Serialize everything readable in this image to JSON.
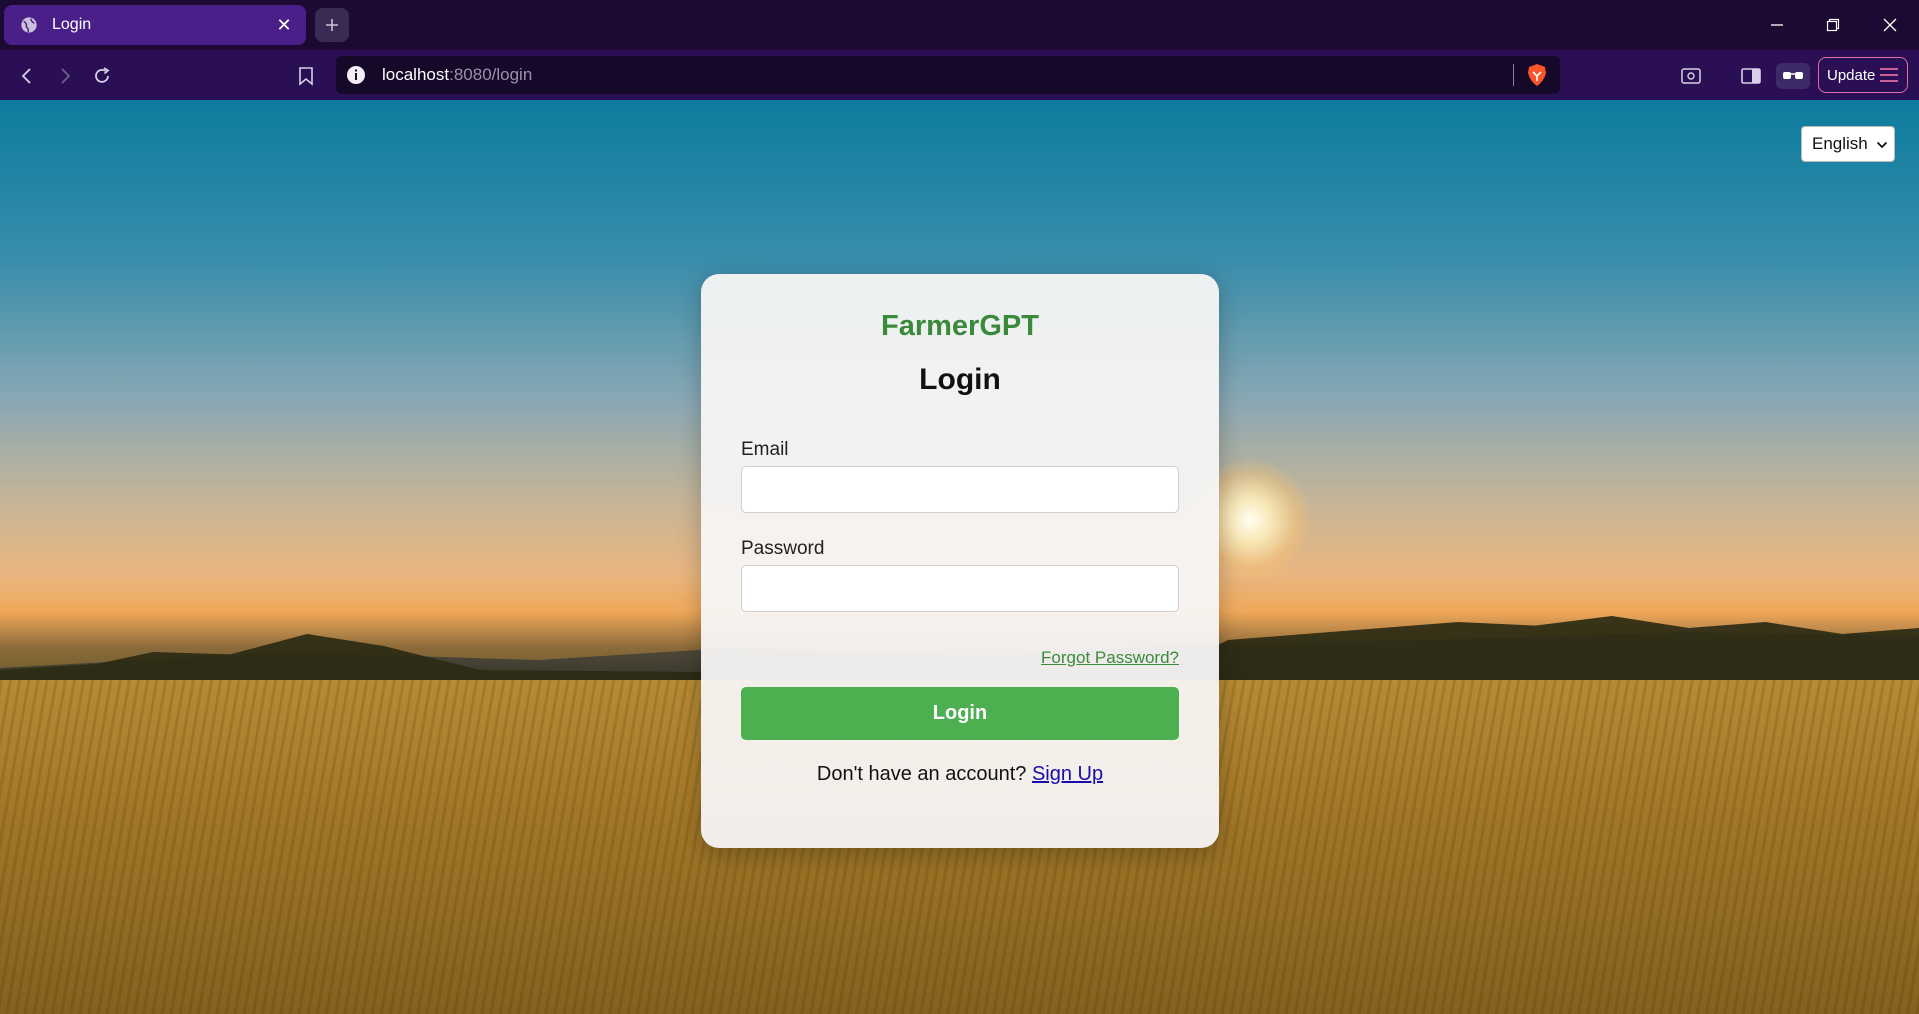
{
  "browser": {
    "tab_title": "Login",
    "url_host": "localhost",
    "url_rest": ":8080/login",
    "update_label": "Update"
  },
  "page": {
    "language": "English",
    "brand": "FarmerGPT",
    "heading": "Login",
    "email_label": "Email",
    "email_value": "",
    "password_label": "Password",
    "password_value": "",
    "forgot_link": "Forgot Password?",
    "login_button": "Login",
    "signup_prompt": "Don't have an account?",
    "signup_link": "Sign Up"
  },
  "colors": {
    "brand_green": "#3b8a3b",
    "button_green": "#4caf50",
    "link_blue": "#1a0dab",
    "chrome_purple": "#2a0f55"
  }
}
